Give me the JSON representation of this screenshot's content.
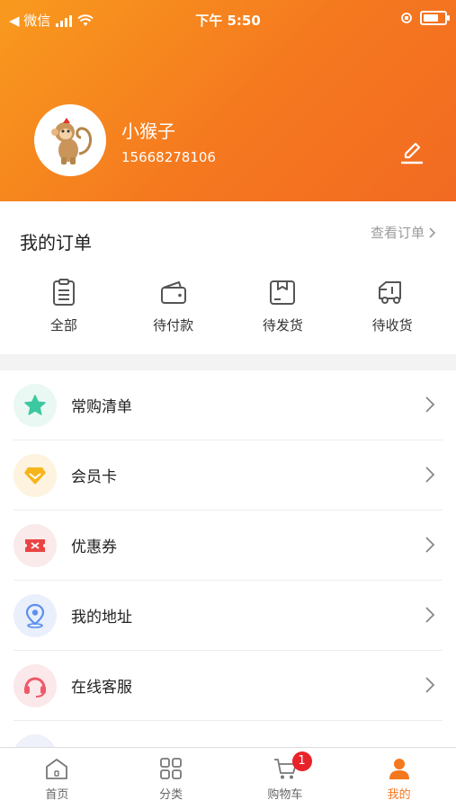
{
  "status_bar": {
    "back_app": "◀ 微信",
    "time": "下午 5:50"
  },
  "profile": {
    "name": "小猴子",
    "phone": "15668278106"
  },
  "orders": {
    "title": "我的订单",
    "view_all": "查看订单",
    "items": [
      {
        "label": "全部",
        "icon": "clipboard-icon"
      },
      {
        "label": "待付款",
        "icon": "wallet-icon"
      },
      {
        "label": "待发货",
        "icon": "package-icon"
      },
      {
        "label": "待收货",
        "icon": "truck-icon"
      }
    ]
  },
  "menu": [
    {
      "label": "常购清单",
      "icon": "star-icon",
      "color": "#3cc8a0",
      "bg": "#eaf8f3"
    },
    {
      "label": "会员卡",
      "icon": "diamond-icon",
      "color": "#f7b51c",
      "bg": "#fdf3de"
    },
    {
      "label": "优惠券",
      "icon": "ticket-icon",
      "color": "#e94444",
      "bg": "#fbeaea"
    },
    {
      "label": "我的地址",
      "icon": "location-icon",
      "color": "#5b8ff0",
      "bg": "#e9f0fc"
    },
    {
      "label": "在线客服",
      "icon": "headset-icon",
      "color": "#ee5a6a",
      "bg": "#fbe8ea"
    }
  ],
  "tabbar": {
    "items": [
      {
        "label": "首页",
        "icon": "home-icon"
      },
      {
        "label": "分类",
        "icon": "grid-icon"
      },
      {
        "label": "购物车",
        "icon": "cart-icon",
        "badge": "1"
      },
      {
        "label": "我的",
        "icon": "user-icon"
      }
    ]
  },
  "colors": {
    "accent": "#f5781f",
    "badge": "#e8222b"
  }
}
